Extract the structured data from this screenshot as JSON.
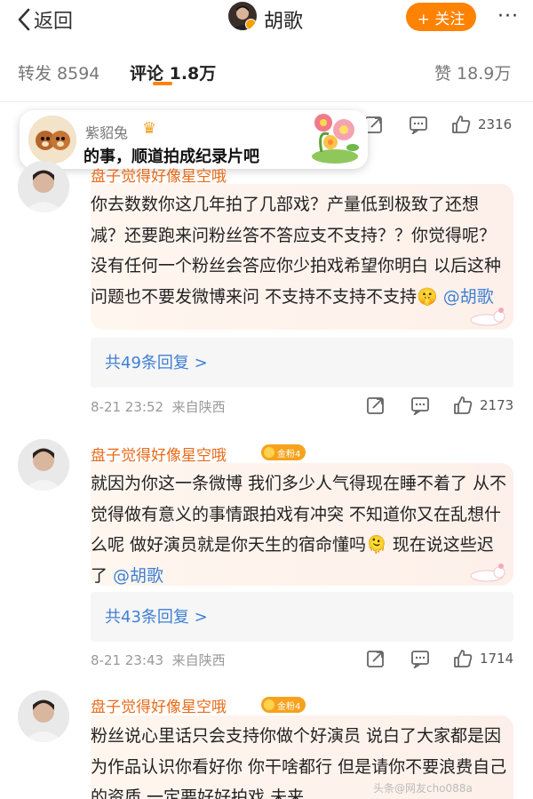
{
  "nav": {
    "back_label": "返回",
    "user_name": "胡歌",
    "follow_label": "+ 关注",
    "more_label": "···"
  },
  "tabs": {
    "repost": "转发 8594",
    "comments": "评论 1.8万",
    "likes": "赞 18.9万"
  },
  "popup": {
    "user": "紫貂兔",
    "text": "的事，顺道拍成纪录片吧"
  },
  "top_actions": {
    "likes": "2316"
  },
  "comments": [
    {
      "name": "盘子觉得好像星空哦",
      "text_parts": [
        "你去数数你这几年拍了几部戏？产量低到极致了还想减？还要跑来问粉丝答不答应支不支持？？你觉得呢？没有任何一个粉丝会答应你少拍戏希望你明白 以后这种问题也不要发微博来问 不支持不支持不支持",
        "🤫",
        " ",
        "@胡歌"
      ],
      "replies": "共49条回复 >",
      "time": "8-21 23:52",
      "source": "来自陕西",
      "likes": "2173"
    },
    {
      "name": "盘子觉得好像星空哦",
      "badge": "金粉4",
      "text_parts": [
        "就因为你这一条微博 我们多少人气得现在睡不着了 从不觉得做有意义的事情跟拍戏有冲突 不知道你又在乱想什么呢 做好演员就是你天生的宿命懂吗",
        "🫠",
        " 现在说这些迟了 ",
        "@胡歌"
      ],
      "replies": "共43条回复 >",
      "time": "8-21 23:43",
      "source": "来自陕西",
      "likes": "1714"
    },
    {
      "name": "盘子觉得好像星空哦",
      "badge": "金粉4",
      "text_parts": [
        "粉丝说心里话只会支持你做个好演员 说白了大家都是因为作品认识你看好你 你干啥都行 但是请你不要浪费自己的资质 一定要好好拍戏 未来"
      ]
    }
  ],
  "watermark": "头条@网友cho088a",
  "colors": {
    "accent": "#ff8200",
    "name": "#e86b1a",
    "link": "#3f7fd4"
  }
}
